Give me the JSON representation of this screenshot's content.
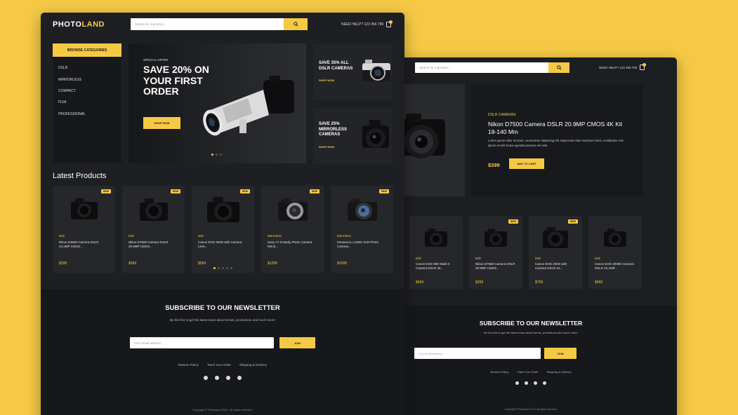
{
  "front": {
    "logo": {
      "part1": "PHOTO",
      "part2": "LAND"
    },
    "search_placeholder": "Search for a product...",
    "support": "NEED HELP? 123 456 789",
    "browse_categories": "BROWSE CATEGORIES",
    "categories": [
      "DSLR",
      "MIRRORLESS",
      "COMPACT",
      "FILM",
      "PROFESSIONAL"
    ],
    "hero": {
      "special": "SPECIAL OFFER",
      "headline": "SAVE 20% ON YOUR FIRST ORDER",
      "button": "SHOP NOW"
    },
    "promos": [
      {
        "title": "SAVE 35% ALL DSLR CAMERAS",
        "link": "SHOP NOW"
      },
      {
        "title": "SAVE 25% MIRRORLESS CAMERAS",
        "link": "SHOP NOW"
      }
    ],
    "latest_title": "Latest Products",
    "new_badge": "NEW",
    "products": [
      {
        "category": "Dslr",
        "name": "Nikon D3500 Camera DSLR 24.2MP CMOS...",
        "price": "$299"
      },
      {
        "category": "Dslr",
        "name": "Nikon D7500 Camera DSLR 20.9MP CMOS...",
        "price": "$399"
      },
      {
        "category": "Dslr",
        "name": "Canon EOS 250D with Camera Lens...",
        "price": "$599"
      },
      {
        "category": "Mirrorless",
        "name": "Sony A7 III Body Photo Camera Mirror...",
        "price": "$1299"
      },
      {
        "category": "Mirrorless",
        "name": "Panasonic LUMIX S1R Photo Camera...",
        "price": "$1099"
      }
    ],
    "newsletter": {
      "title": "SUBSCRIBE TO OUR NEWSLETTER",
      "subtitle": "Be the first to get the latest news about trends, promotions and much more!",
      "placeholder": "Your email address",
      "join": "JOIN",
      "links": [
        "Returns Policy",
        "Track Your Order",
        "Shipping & Delivery"
      ]
    },
    "copyright": "Copyright © Photoland 2022. All rights reserved."
  },
  "back": {
    "search_placeholder": "Search for a product...",
    "support": "NEED HELP? 123 456 789",
    "detail": {
      "category": "DSLR CAMERAS",
      "name": "Nikon D7500 Camera DSLR 20.9MP CMOS 4K Kit 18-140 Mm",
      "description": "Lorem ipsum dolor sit amet, consectetur adipiscing elit. Maecenas vitae maximus lorem, vestibulum erat ipsum at velit luctus egestas posuere vel ante.",
      "price": "$399",
      "add_to_cart": "ADD TO CART"
    },
    "new_badge": "NEW",
    "products": [
      {
        "category": "Dslr",
        "name": "Canon EOS 90D Mark II Camera DSLR 26...",
        "price": "$499"
      },
      {
        "category": "Dslr",
        "name": "Nikon D7500 Camera DSLR 20.9MP CMOS...",
        "price": "$399"
      },
      {
        "category": "Dslr",
        "name": "Canon EOS 250D with Camera DSLR 24...",
        "price": "$799"
      },
      {
        "category": "Dslr",
        "name": "Canon EOS 2000D Camera DSLR 24.1MP...",
        "price": "$499"
      }
    ],
    "newsletter": {
      "title": "SUBSCRIBE TO OUR NEWSLETTER",
      "subtitle": "Be the first to get the latest news about trends, promotions and much more!",
      "placeholder": "Your email address",
      "join": "JOIN",
      "links": [
        "Returns Policy",
        "Track Your Order",
        "Shipping & Delivery"
      ]
    },
    "copyright": "Copyright © Photoland 2022. All rights reserved."
  },
  "colors": {
    "accent": "#f6c945",
    "background": "#f6c945",
    "panel": "#1e1f22"
  },
  "icons": [
    "search-icon",
    "shopping-bag-icon",
    "youtube-icon",
    "instagram-icon",
    "twitter-icon",
    "pinterest-icon"
  ]
}
